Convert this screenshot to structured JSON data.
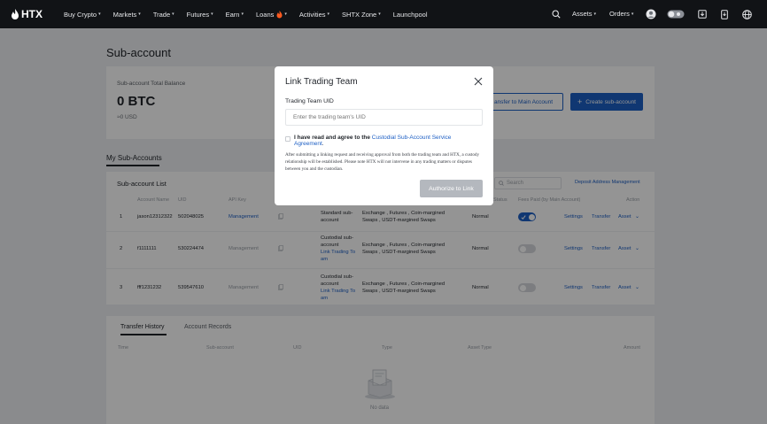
{
  "nav": {
    "brand": "HTX",
    "items": [
      {
        "label": "Buy Crypto",
        "dropdown": true
      },
      {
        "label": "Markets",
        "dropdown": true
      },
      {
        "label": "Trade",
        "dropdown": true
      },
      {
        "label": "Futures",
        "dropdown": true
      },
      {
        "label": "Earn",
        "dropdown": true
      },
      {
        "label": "Loans",
        "dropdown": true,
        "badge_icon": "fire-icon"
      },
      {
        "label": "Activities",
        "dropdown": true
      },
      {
        "label": "SHTX Zone",
        "dropdown": true
      },
      {
        "label": "Launchpool",
        "dropdown": false
      }
    ],
    "right": {
      "assets": "Assets",
      "orders": "Orders",
      "icons": [
        "search-icon",
        "avatar-icon",
        "toggle-icon",
        "download-icon",
        "mobile-icon",
        "globe-icon"
      ]
    }
  },
  "page": {
    "title": "Sub-account",
    "balance_label": "Sub-account Total Balance",
    "balance_value": "0 BTC",
    "balance_usd": "≈0 USD",
    "transfer_button": "Transfer to Main Account",
    "transfer_button_visible": "ansfer to Main Account",
    "create_button": "Create sub-account",
    "tab_my": "My Sub-Accounts",
    "list_title": "Sub-account List",
    "search_placeholder": "Search",
    "deposit_link": "Deposit Address Management",
    "columns": [
      "Account Name",
      "UID",
      "API Key",
      "Status",
      "Fees Paid (by Main Account)",
      "Action"
    ],
    "rows": [
      {
        "index": "1",
        "name": "jason12312322",
        "uid": "502048025",
        "api": "Management",
        "type_lines": [
          "Standard sub-",
          "account"
        ],
        "type_link": [],
        "perm_lines": [
          "Exchange , Futures , Coin-margined",
          "Swaps , USDT-margined Swaps"
        ],
        "status": "Normal",
        "fees_on": true
      },
      {
        "index": "2",
        "name": "f1111111",
        "uid": "530224474",
        "api": "Management",
        "type_lines": [
          "Custodial sub-",
          "account"
        ],
        "type_link": [
          "Link Trading To",
          "am"
        ],
        "perm_lines": [
          "Exchange , Futures , Coin-margined",
          "Swaps , USDT-margined Swaps"
        ],
        "status": "Normal",
        "fees_on": false
      },
      {
        "index": "3",
        "name": "fff1231232",
        "uid": "539547610",
        "api": "Management",
        "type_lines": [
          "Custodial sub-",
          "account"
        ],
        "type_link": [
          "Link Trading To",
          "am"
        ],
        "perm_lines": [
          "Exchange , Futures , Coin-margined",
          "Swaps , USDT-margined Swaps"
        ],
        "status": "Normal",
        "fees_on": false
      }
    ],
    "actions": {
      "settings": "Settings",
      "transfer": "Transfer",
      "asset": "Asset"
    },
    "bottom_tabs": [
      "Transfer History",
      "Account Records"
    ],
    "bottom_columns": [
      "Time",
      "Sub-account",
      "UID",
      "Type",
      "Asset Type",
      "Amount"
    ],
    "no_data": "No data"
  },
  "modal": {
    "title": "Link Trading Team",
    "field_label": "Trading Team UID",
    "input_placeholder": "Enter the trading team's UID",
    "agree_prefix": "I have read and agree to the ",
    "agree_link": "Custodial Sub-Account Service Agreement",
    "agree_suffix": ".",
    "note": "After submitting a linking request and receiving approval from both the trading team and HTX, a custody relationship will be established. Please note HTX will not intervene in any trading matters or disputes between you and the custodian.",
    "submit_button": "Authorize to Link"
  },
  "colors": {
    "accent": "#1d5fc4",
    "nav_bg": "#111316",
    "disabled": "#b4b8be"
  }
}
